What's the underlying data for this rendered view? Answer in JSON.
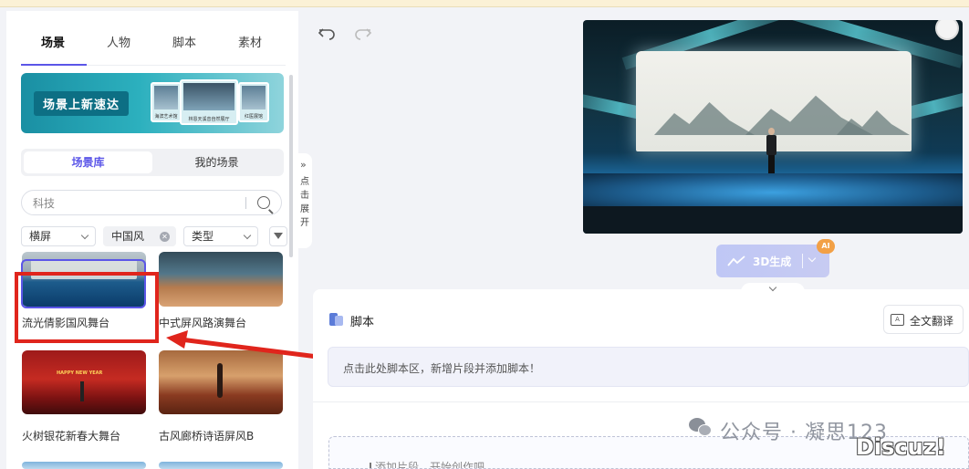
{
  "left_panel": {
    "tabs": [
      {
        "label": "场景",
        "active": true
      },
      {
        "label": "人物",
        "active": false
      },
      {
        "label": "脚本",
        "active": false
      },
      {
        "label": "素材",
        "active": false
      }
    ],
    "banner": {
      "title": "场景上新速达",
      "cards": [
        "海滨艺术馆",
        "林恩天溪音自然展厅",
        "红医展馆"
      ]
    },
    "segments": [
      {
        "label": "场景库",
        "active": true
      },
      {
        "label": "我的场景",
        "active": false
      }
    ],
    "search": {
      "value": "科技"
    },
    "filters": {
      "orientation": "横屏",
      "tag": "中国风",
      "type": "类型"
    },
    "scene_items": [
      {
        "label": "流光倩影国风舞台",
        "selected": true
      },
      {
        "label": "中式屏风路演舞台",
        "selected": false
      },
      {
        "label": "火树银花新春大舞台",
        "selected": false
      },
      {
        "label": "古风廊桥诗语屏风B",
        "selected": false
      }
    ],
    "thumb_text": "HAPPY NEW YEAR",
    "expand_tab": {
      "arrows": "»",
      "label": "点击展开"
    }
  },
  "toolbar": {
    "undo": "undo-icon",
    "redo": "redo-icon"
  },
  "generate": {
    "label": "3D生成",
    "badge": "AI"
  },
  "script": {
    "title": "脚本",
    "translate_label": "全文翻译",
    "hint": "点击此处脚本区，新增片段并添加脚本！",
    "add_segment_partial": "添加片段，开始创作吧"
  },
  "watermark": {
    "text": "公众号 · 凝思123",
    "site": "Discuz!"
  },
  "colors": {
    "accent": "#5b56e8",
    "annotation_red": "#e0251c",
    "ai_badge": "#f2a046"
  }
}
